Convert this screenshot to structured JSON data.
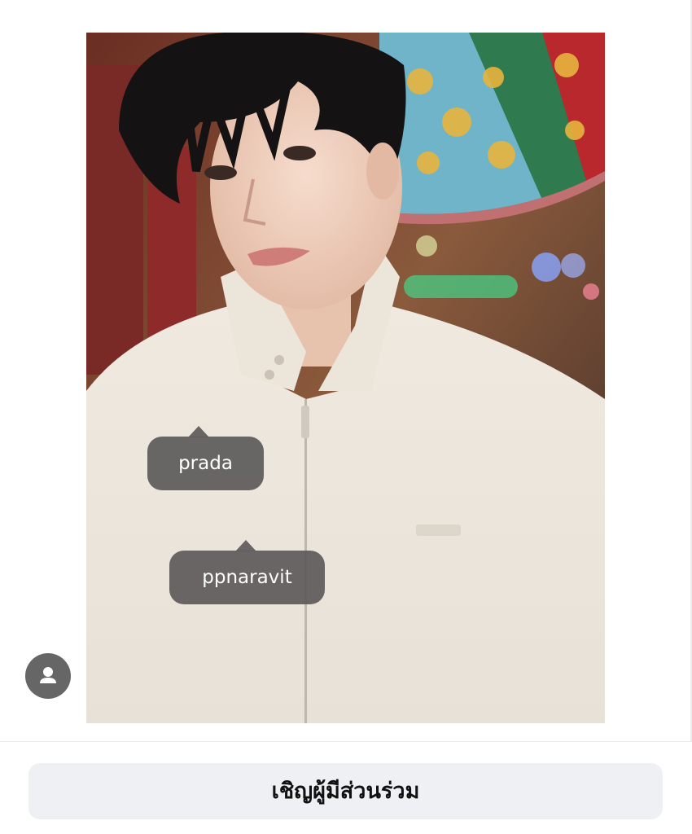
{
  "photo": {
    "alt": "photo"
  },
  "tags": [
    {
      "label": "prada"
    },
    {
      "label": "ppnaravit"
    }
  ],
  "tag_user_button": {
    "icon": "person-icon"
  },
  "footer": {
    "invite_label": "เชิญผู้มีส่วนร่วม"
  },
  "colors": {
    "tag_background": "#5c5a5a",
    "button_background": "#eef0f3",
    "user_button": "#666666"
  }
}
